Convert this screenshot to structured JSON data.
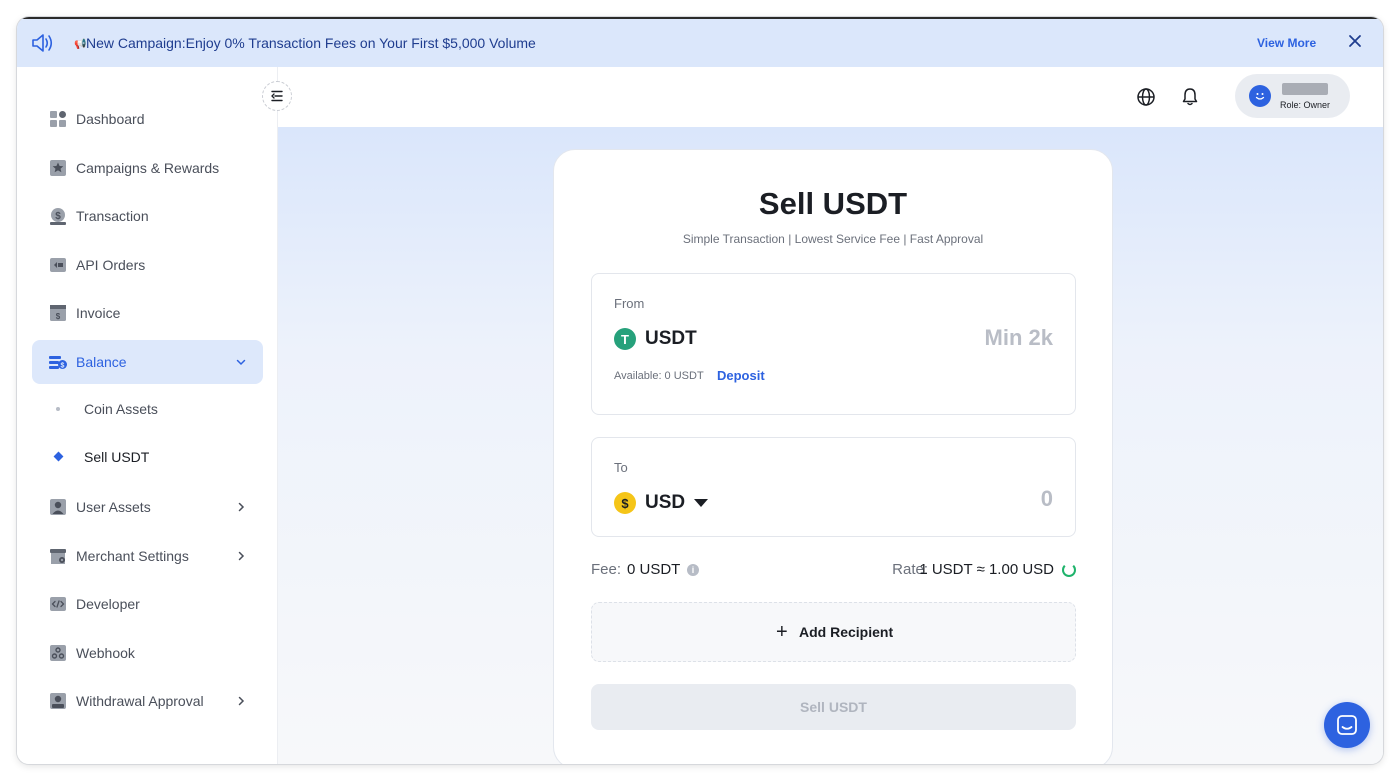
{
  "banner": {
    "flag_glyph": "📢",
    "message": "New Campaign:Enjoy 0% Transaction Fees on Your First $5,000 Volume",
    "view_more": "View More"
  },
  "sidebar": {
    "items": [
      {
        "label": "Dashboard",
        "icon": "dashboard-icon"
      },
      {
        "label": "Campaigns & Rewards",
        "icon": "star-icon"
      },
      {
        "label": "Transaction",
        "icon": "dollar-hand-icon"
      },
      {
        "label": "API Orders",
        "icon": "api-icon"
      },
      {
        "label": "Invoice",
        "icon": "invoice-icon"
      },
      {
        "label": "Balance",
        "icon": "wallet-icon",
        "expanded": true,
        "active": true
      },
      {
        "label": "User Assets",
        "icon": "user-icon"
      },
      {
        "label": "Merchant Settings",
        "icon": "store-gear-icon"
      },
      {
        "label": "Developer",
        "icon": "code-icon"
      },
      {
        "label": "Webhook",
        "icon": "webhook-icon"
      },
      {
        "label": "Withdrawal Approval",
        "icon": "approval-icon"
      }
    ],
    "balance_sub": [
      {
        "label": "Coin Assets"
      },
      {
        "label": "Sell USDT",
        "selected": true
      }
    ]
  },
  "header": {
    "user_role": "Role: Owner"
  },
  "card": {
    "title": "Sell USDT",
    "subtitle": "Simple Transaction | Lowest Service Fee | Fast Approval",
    "from": {
      "label": "From",
      "coin": "USDT",
      "coin_glyph": "T",
      "amount_placeholder": "Min 2k",
      "available": "Available: 0 USDT",
      "deposit": "Deposit"
    },
    "to": {
      "label": "To",
      "currency": "USD",
      "currency_glyph": "$",
      "value": "0"
    },
    "fee_label": "Fee:",
    "fee_value": "0 USDT",
    "rate_label": "Rate:",
    "rate_value": "1 USDT ≈ 1.00 USD",
    "add_recipient": "Add Recipient",
    "submit": "Sell USDT"
  },
  "colors": {
    "accent": "#2d62e0",
    "banner_bg": "#dbe7fb",
    "usdt_green": "#26a17b",
    "usd_yellow": "#f5c518"
  }
}
